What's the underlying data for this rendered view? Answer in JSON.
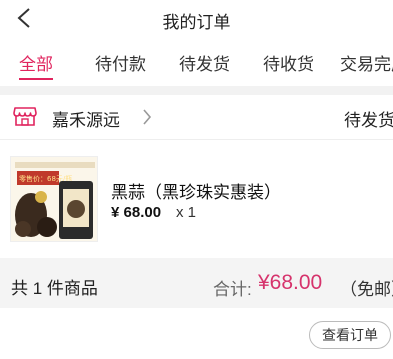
{
  "header": {
    "title": "我的订单"
  },
  "tabs": [
    {
      "label": "全部"
    },
    {
      "label": "待付款"
    },
    {
      "label": "待发货"
    },
    {
      "label": "待收货"
    },
    {
      "label": "交易完成"
    }
  ],
  "order": {
    "store_name": "嘉禾源远",
    "status": "待发货",
    "product": {
      "name": "黑蒜（黑珍珠实惠装）",
      "price": "¥ 68.00",
      "quantity": "x 1",
      "image_label": "零售价：68元/瓶"
    },
    "summary": {
      "count": "共 1 件商品",
      "total_label": "合计:",
      "total_value": "¥68.00",
      "shipping": "（免邮）"
    },
    "view_button": "查看订单"
  },
  "colors": {
    "accent": "#e0245e",
    "price": "#d6336c"
  }
}
